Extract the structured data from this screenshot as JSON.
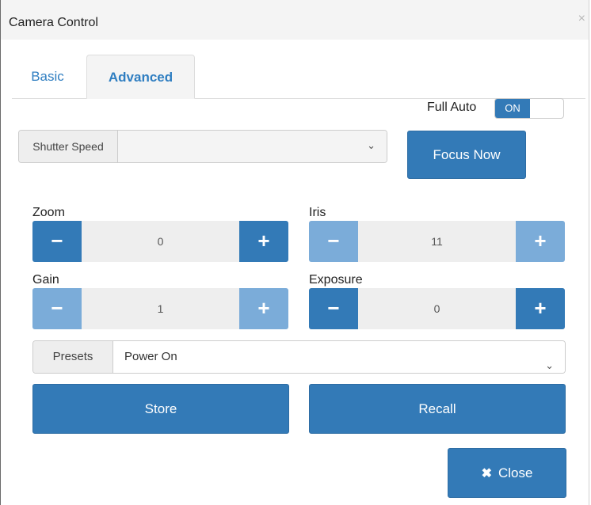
{
  "window": {
    "title": "Camera Control",
    "close_glyph": "×"
  },
  "tabs": [
    {
      "label": "Basic",
      "active": false
    },
    {
      "label": "Advanced",
      "active": true
    }
  ],
  "full_auto": {
    "label": "Full Auto",
    "state": "ON"
  },
  "shutter_speed": {
    "label": "Shutter Speed",
    "value": ""
  },
  "focus_now": {
    "label": "Focus Now"
  },
  "controls": {
    "zoom": {
      "label": "Zoom",
      "value": "0",
      "minus_enabled": true,
      "plus_enabled": true
    },
    "iris": {
      "label": "Iris",
      "value": "11",
      "minus_enabled": false,
      "plus_enabled": false
    },
    "gain": {
      "label": "Gain",
      "value": "1",
      "minus_enabled": false,
      "plus_enabled": false
    },
    "exposure": {
      "label": "Exposure",
      "value": "0",
      "minus_enabled": true,
      "plus_enabled": true
    }
  },
  "stepper_glyphs": {
    "minus": "−",
    "plus": "+"
  },
  "presets": {
    "label": "Presets",
    "value": "Power On"
  },
  "buttons": {
    "store": "Store",
    "recall": "Recall",
    "close": "Close",
    "close_icon": "✖"
  },
  "chevron_glyph": "⌄",
  "colors": {
    "primary": "#337ab7",
    "primary_disabled": "#7bacd9",
    "tab_text": "#2f7ec1"
  }
}
